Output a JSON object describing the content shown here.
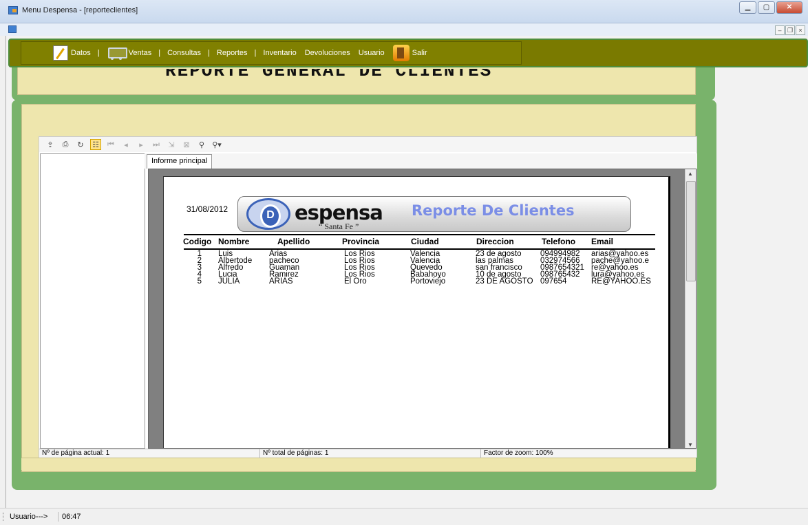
{
  "window": {
    "title": "Menu Despensa - [reporteclientes]"
  },
  "menu": [
    {
      "label": "Datos",
      "icon": "edit-icon"
    },
    {
      "label": "Ventas",
      "icon": "cart-icon"
    },
    {
      "label": "Consultas"
    },
    {
      "label": "Reportes"
    },
    {
      "label": "Inventario"
    },
    {
      "label": "Devoluciones"
    },
    {
      "label": "Usuario"
    },
    {
      "label": "Salir",
      "icon": "exit-icon"
    }
  ],
  "menu_sep": "|",
  "report_heading": "REPORTE GENERAL DE CLIENTES",
  "viewer": {
    "tab_label": "Informe principal",
    "status": {
      "current_page": "Nº de página actual: 1",
      "total_pages": "Nº total de páginas: 1",
      "zoom": "Factor de zoom: 100%"
    }
  },
  "report": {
    "date": "31/08/2012",
    "brand": "espensa",
    "brand_sub": "“ Santa Fe ”",
    "brand_initial": "D",
    "title": "Reporte De Clientes",
    "columns": [
      "Codigo",
      "Nombre",
      "Apellido",
      "Provincia",
      "Ciudad",
      "Direccion",
      "Telefono",
      "Email"
    ],
    "rows": [
      [
        "1",
        "Luis",
        "Arias",
        "Los Rios",
        "Valencia",
        "23 de agosto",
        "094994982",
        "arias@yahoo.es"
      ],
      [
        "2",
        "Albertode",
        "pacheco",
        "Los Rios",
        "Valencia",
        "las palmas",
        "032974566",
        "pache@yahoo.e"
      ],
      [
        "3",
        "Alfredo",
        "Guaman",
        "Los Rios",
        "Quevedo",
        "san francisco",
        "0987654321",
        "re@yahoo.es"
      ],
      [
        "4",
        "Lucia",
        "Ramirez",
        "Los Rios",
        "Babahoyo",
        "10 de agosto",
        "098765432",
        "lura@yahoo.es"
      ],
      [
        "5",
        "JULIA",
        "ARIAS",
        "El Oro",
        "Portoviejo",
        "23 DE AGOSTO",
        "097654",
        "RE@YAHOO.ES"
      ]
    ]
  },
  "statusbar": {
    "user_label": "Usuario--->",
    "time": "06:47"
  },
  "colors": {
    "menu_bg": "#808000",
    "panel_border": "#79b36b",
    "panel_fill": "#eee6ad",
    "logo_title": "#7b8ee6"
  }
}
